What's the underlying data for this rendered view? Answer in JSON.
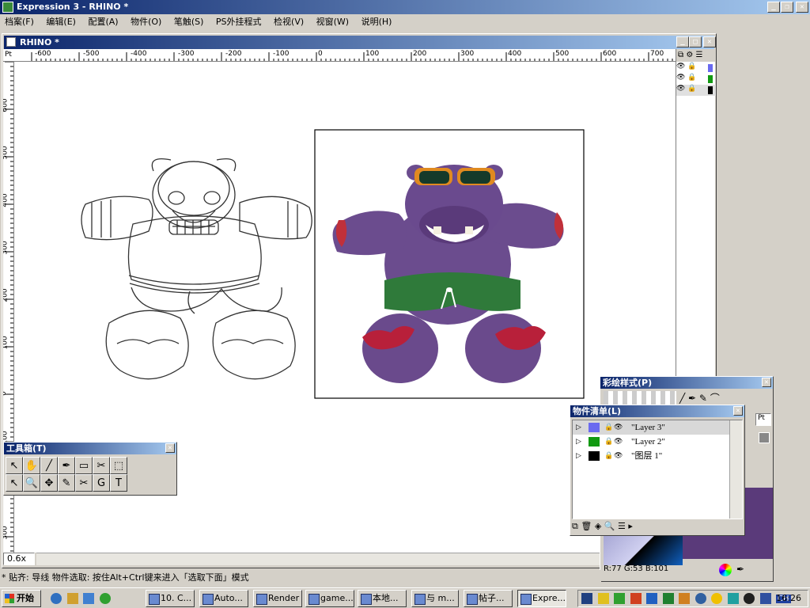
{
  "app": {
    "title": "Expression 3 - RHINO *",
    "menu": [
      "档案(F)",
      "编辑(E)",
      "配置(A)",
      "物件(O)",
      "笔触(S)",
      "PS外挂程式",
      "检视(V)",
      "视窗(W)",
      "说明(H)"
    ]
  },
  "document": {
    "title": "RHINO *",
    "ruler_unit": "Pt",
    "h_ruler_labels": [
      "-600",
      "-500",
      "-400",
      "-300",
      "-200",
      "-100",
      "0",
      "100",
      "200",
      "300",
      "400",
      "500",
      "600",
      "700"
    ],
    "v_ruler_labels": [
      "600",
      "500",
      "400",
      "300",
      "200",
      "100",
      "0",
      "100",
      "200",
      "300"
    ],
    "zoom": "0.6x"
  },
  "toolbox": {
    "title": "工具箱(T)",
    "tools": [
      {
        "name": "select-arrow-icon",
        "glyph": "↖"
      },
      {
        "name": "hand-icon",
        "glyph": "✋"
      },
      {
        "name": "brush-icon",
        "glyph": "╱"
      },
      {
        "name": "eyedropper-icon",
        "glyph": "✒"
      },
      {
        "name": "rectangle-icon",
        "glyph": "▭"
      },
      {
        "name": "scissors-icon",
        "glyph": "✂"
      },
      {
        "name": "marquee-icon",
        "glyph": "⬚"
      },
      {
        "name": "subselect-arrow-icon",
        "glyph": "↖"
      },
      {
        "name": "zoom-icon",
        "glyph": "🔍"
      },
      {
        "name": "node-icon",
        "glyph": "✥"
      },
      {
        "name": "pen-icon",
        "glyph": "✎"
      },
      {
        "name": "knife-icon",
        "glyph": "✂"
      },
      {
        "name": "spiral-icon",
        "glyph": "G"
      },
      {
        "name": "text-icon",
        "glyph": "T"
      }
    ]
  },
  "stroke_panel": {
    "title": "彩绘样式(P)",
    "unit": "Pt"
  },
  "object_list": {
    "title": "物件清单(L)",
    "layers": [
      {
        "label": "\"Layer 3\"",
        "color": "#6a6af0",
        "selected": true
      },
      {
        "label": "\"Layer 2\"",
        "color": "#119911",
        "selected": false
      },
      {
        "label": "\"图层 1\"",
        "color": "#000000",
        "selected": false
      }
    ]
  },
  "color_panel": {
    "readout": "R:77  G:53  B:101"
  },
  "status_bar": {
    "text": "* 贴齐: 导线   物件选取: 按住Alt+Ctrl键来进入「选取下面」模式"
  },
  "taskbar": {
    "start": "开始",
    "tasks": [
      "10. C...",
      "Auto...",
      "Render",
      "game...",
      "本地...",
      "与 m...",
      "帖子...",
      "Expre..."
    ],
    "clock": "16:26",
    "lang": "CH"
  },
  "colors": {
    "title_active": "#0a246a",
    "hippo_body": "#6b4c8e",
    "shorts": "#2f7a3a",
    "toes": "#c0303a",
    "glasses": "#e08a20"
  }
}
